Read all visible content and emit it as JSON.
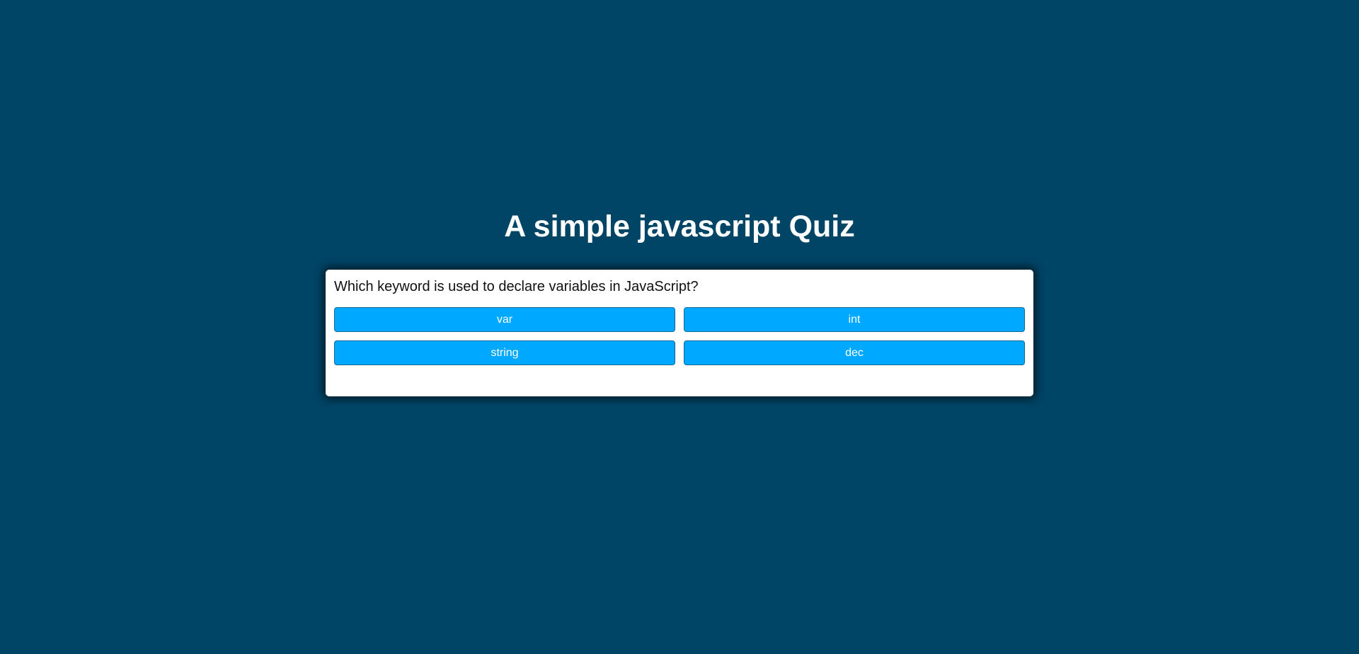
{
  "app": {
    "title": "A simple javascript Quiz"
  },
  "quiz": {
    "question": "Which keyword is used to declare variables in JavaScript?",
    "answers": [
      {
        "label": "var"
      },
      {
        "label": "int"
      },
      {
        "label": "string"
      },
      {
        "label": "dec"
      }
    ]
  },
  "colors": {
    "background": "#004466",
    "card": "#ffffff",
    "button": "#00a8ff",
    "button_border": "#0a6b9a",
    "title_text": "#ffffff"
  }
}
